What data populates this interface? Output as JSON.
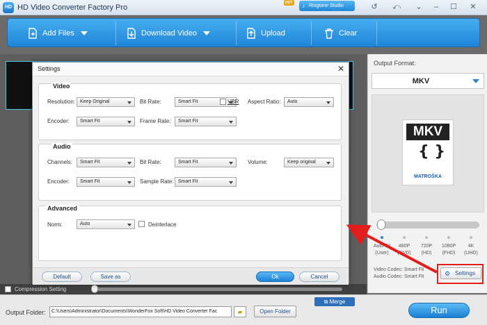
{
  "app": {
    "title": "HD Video Converter Factory Pro",
    "logo_text": "HD",
    "hot_badge": "HOT",
    "ringtone_label": "Ringtone Studio"
  },
  "toolbar": {
    "add_files": "Add Files",
    "download_video": "Download Video",
    "upload": "Upload",
    "clear": "Clear"
  },
  "output_format": {
    "label": "Output Format:",
    "selected": "MKV",
    "logo_top": "MKV",
    "logo_glyph": "{ }",
    "logo_sub": "MATROŠKA"
  },
  "quality": {
    "level_fraction": 0.0,
    "options": [
      {
        "line1": "Auto Fit",
        "line2": "(User)"
      },
      {
        "line1": "480P",
        "line2": "(DVD)"
      },
      {
        "line1": "720P",
        "line2": "(HD)"
      },
      {
        "line1": "1080P",
        "line2": "(FHD)"
      },
      {
        "line1": "4K",
        "line2": "(UHD)"
      }
    ]
  },
  "codecs": {
    "video": "Video Codec: Smart Fit",
    "audio": "Audio Codec: Smart Fit"
  },
  "settings_button": "Settings",
  "compression": {
    "label": "Compression Setting",
    "level_fraction": 0.0
  },
  "bottom": {
    "output_folder_label": "Output Folder:",
    "output_folder_value": "C:\\Users\\Administrator\\Documents\\WonderFox Soft\\HD Video Converter Fac",
    "open_folder": "Open Folder",
    "merge": "Merge",
    "run": "Run"
  },
  "dialog": {
    "title": "Settings",
    "video": {
      "title": "Video",
      "resolution_label": "Resolution:",
      "resolution_value": "Keep Original",
      "bitrate_label": "Bit Rate:",
      "bitrate_value": "Smart Fit",
      "vbr_label": "VBR",
      "aspect_label": "Aspect Ratio:",
      "aspect_value": "Auto",
      "encoder_label": "Encoder:",
      "encoder_value": "Smart Fit",
      "framerate_label": "Frame Rate:",
      "framerate_value": "Smart Fit"
    },
    "audio": {
      "title": "Audio",
      "channels_label": "Channels:",
      "channels_value": "Smart Fit",
      "bitrate_label": "Bit Rate:",
      "bitrate_value": "Smart Fit",
      "volume_label": "Volume:",
      "volume_value": "Keep original",
      "encoder_label": "Encoder:",
      "encoder_value": "Smart Fit",
      "samplerate_label": "Sample Rate:",
      "samplerate_value": "Smart Fit"
    },
    "advanced": {
      "title": "Advanced",
      "norm_label": "Norm:",
      "norm_value": "Auto",
      "deinterlace_label": "Deinterlace"
    },
    "buttons": {
      "default": "Default",
      "save_as": "Save as",
      "ok": "Ok",
      "cancel": "Cancel"
    }
  },
  "colors": {
    "accent": "#1f84d7",
    "annotation": "#e31c1c"
  }
}
